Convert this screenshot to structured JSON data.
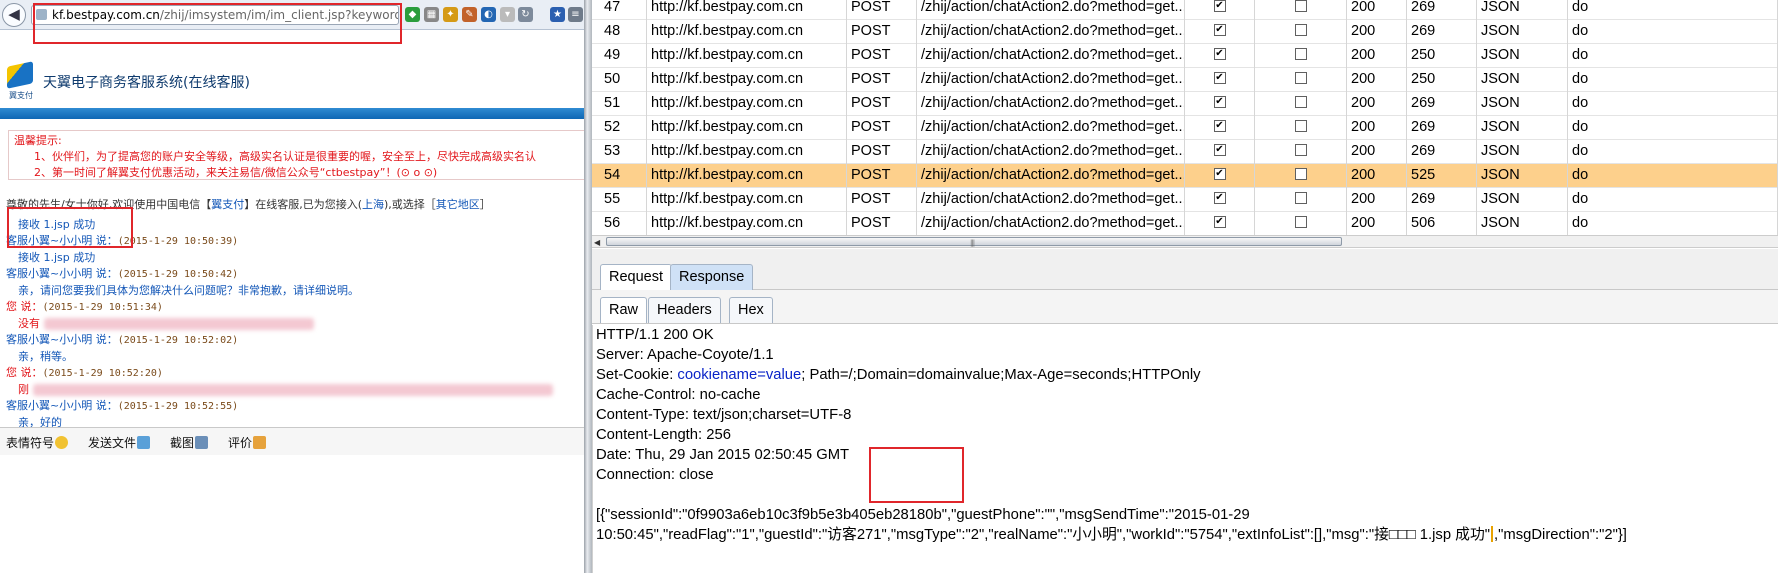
{
  "browser": {
    "url_host": "kf.bestpay.com.cn",
    "url_path": "/zhij/imsystem/im/im_client.jsp?keyword=",
    "back_glyph": "◀"
  },
  "site": {
    "logo_caption": "翼支付",
    "title": "天翼电子商务客服系统(在线客服)"
  },
  "notice": {
    "heading": "温馨提示:",
    "line1": "1、伙伴们，为了提高您的账户安全等级，高级实名认证是很重要的喔，安全至上，尽快完成高级实名认",
    "line2": "2、第一时间了解翼支付优惠活动，来关注易信/微信公众号“ctbestpay”！(⊙ o ⊙)"
  },
  "welcome": {
    "prefix": "尊敬的先生/女士你好,欢迎使用中国电信【",
    "brand": "翼支付",
    "mid": "】在线客服,已为您接入(",
    "region": "上海",
    "mid2": "),或选择［",
    "other_region": "其它地区",
    "suffix": "］"
  },
  "chat": {
    "m0_body": "接收 1.jsp 成功",
    "m1_who": "客服小翼~小小明 说：",
    "m1_time": "(2015-1-29 10:50:39)",
    "m1_body": "接收 1.jsp 成功",
    "m2_who": "客服小翼~小小明 说：",
    "m2_time": "(2015-1-29 10:50:42)",
    "m2_body": "亲，请问您要我们具体为您解决什么问题呢？非常抱歉，请详细说明。",
    "m3_who": "您 说：",
    "m3_time": "(2015-1-29 10:51:34)",
    "m3_body": "没有",
    "m4_who": "客服小翼~小小明 说：",
    "m4_time": "(2015-1-29 10:52:02)",
    "m4_body": "亲，稍等。",
    "m5_who": "您 说：",
    "m5_time": "(2015-1-29 10:52:20)",
    "m5_body": "刚",
    "m6_who": "客服小翼~小小明 说：",
    "m6_time": "(2015-1-29 10:52:55)",
    "m6_body": "亲，好的"
  },
  "tools": {
    "emoji": "表情符号",
    "send_file": "发送文件",
    "screenshot": "截图",
    "rate": "评价"
  },
  "history": {
    "check_glyph": "✔",
    "rows": [
      {
        "n": "47",
        "host": "http://kf.bestpay.com.cn",
        "method": "POST",
        "url": "/zhij/action/chatAction2.do?method=get...",
        "params": true,
        "edited": false,
        "status": "200",
        "len": "269",
        "mime": "JSON",
        "ext": "do"
      },
      {
        "n": "48",
        "host": "http://kf.bestpay.com.cn",
        "method": "POST",
        "url": "/zhij/action/chatAction2.do?method=get...",
        "params": true,
        "edited": false,
        "status": "200",
        "len": "269",
        "mime": "JSON",
        "ext": "do"
      },
      {
        "n": "49",
        "host": "http://kf.bestpay.com.cn",
        "method": "POST",
        "url": "/zhij/action/chatAction2.do?method=get...",
        "params": true,
        "edited": false,
        "status": "200",
        "len": "250",
        "mime": "JSON",
        "ext": "do"
      },
      {
        "n": "50",
        "host": "http://kf.bestpay.com.cn",
        "method": "POST",
        "url": "/zhij/action/chatAction2.do?method=get...",
        "params": true,
        "edited": false,
        "status": "200",
        "len": "250",
        "mime": "JSON",
        "ext": "do"
      },
      {
        "n": "51",
        "host": "http://kf.bestpay.com.cn",
        "method": "POST",
        "url": "/zhij/action/chatAction2.do?method=get...",
        "params": true,
        "edited": false,
        "status": "200",
        "len": "269",
        "mime": "JSON",
        "ext": "do"
      },
      {
        "n": "52",
        "host": "http://kf.bestpay.com.cn",
        "method": "POST",
        "url": "/zhij/action/chatAction2.do?method=get...",
        "params": true,
        "edited": false,
        "status": "200",
        "len": "269",
        "mime": "JSON",
        "ext": "do"
      },
      {
        "n": "53",
        "host": "http://kf.bestpay.com.cn",
        "method": "POST",
        "url": "/zhij/action/chatAction2.do?method=get...",
        "params": true,
        "edited": false,
        "status": "200",
        "len": "269",
        "mime": "JSON",
        "ext": "do"
      },
      {
        "n": "54",
        "host": "http://kf.bestpay.com.cn",
        "method": "POST",
        "url": "/zhij/action/chatAction2.do?method=get...",
        "params": true,
        "edited": false,
        "status": "200",
        "len": "525",
        "mime": "JSON",
        "ext": "do",
        "selected": true
      },
      {
        "n": "55",
        "host": "http://kf.bestpay.com.cn",
        "method": "POST",
        "url": "/zhij/action/chatAction2.do?method=get...",
        "params": true,
        "edited": false,
        "status": "200",
        "len": "269",
        "mime": "JSON",
        "ext": "do"
      },
      {
        "n": "56",
        "host": "http://kf.bestpay.com.cn",
        "method": "POST",
        "url": "/zhij/action/chatAction2.do?method=get...",
        "params": true,
        "edited": false,
        "status": "200",
        "len": "506",
        "mime": "JSON",
        "ext": "do"
      }
    ]
  },
  "tabs": {
    "request": "Request",
    "response": "Response",
    "raw": "Raw",
    "headers": "Headers",
    "hex": "Hex"
  },
  "response": {
    "l1": "HTTP/1.1 200 OK",
    "l2": "Server: Apache-Coyote/1.1",
    "l3_pre": "Set-Cookie: ",
    "l3_kv": "cookiename=value",
    "l3_post": "; Path=/;Domain=domainvalue;Max-Age=seconds;HTTPOnly",
    "l4": "Cache-Control: no-cache",
    "l5": "Content-Type: text/json;charset=UTF-8",
    "l6": "Content-Length: 256",
    "l7": "Date: Thu, 29 Jan 2015 02:50:45 GMT",
    "l8": "Connection: close",
    "j1": "[{\"sessionId\":\"0f9903a6eb10c3f9b5e3b405eb28180b\",\"guestPhone\":\"\",\"msgSendTime\":\"2015-01-29",
    "j2a": "10:50:45\",\"readFlag\":\"1\",\"guestId\":\"访客271\",\"msgType\":\"2\",\"realName\":\"小小明\",\"workId\":\"5754\",\"extInfoList\":[],\"msg\":\"接□□□ 1.jsp 成功\"",
    "j2b": ",\"msgDirection\":\"2\"}]"
  },
  "colors": {
    "selected_row": "#fdd08c",
    "red_highlight": "#e0262b",
    "chat_service": "#1256b7",
    "chat_user": "#e2161b"
  }
}
